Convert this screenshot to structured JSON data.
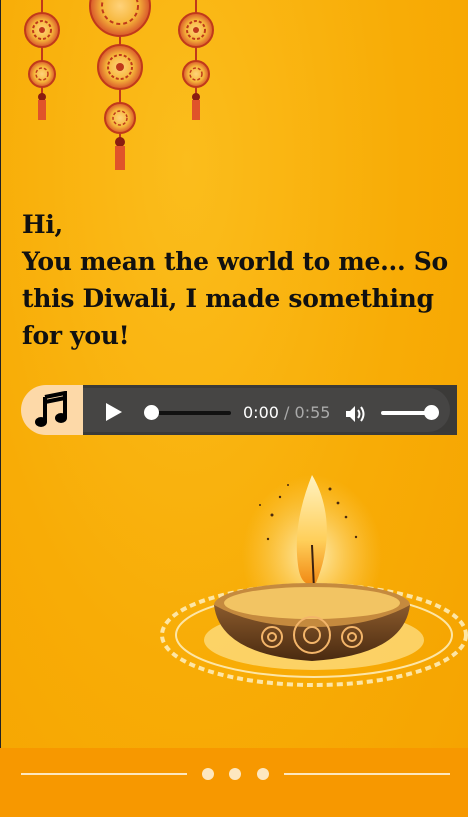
{
  "greeting": {
    "hi": "Hi,",
    "message": "You mean the world to me... So this Diwali, I made something for you!"
  },
  "audio": {
    "current_time": "0:00",
    "separator": "/",
    "duration": "0:55",
    "progress": 0,
    "volume": 1
  },
  "icons": [
    "music-note-icon",
    "play-icon",
    "volume-icon"
  ],
  "colors": {
    "background": "#f8ac06",
    "footer": "#f79800",
    "player_bg": "#3b3a38",
    "music_button_bg": "#fdd9a8",
    "text": "#111111"
  },
  "carousel": {
    "dots": 3,
    "active_index": 0
  }
}
